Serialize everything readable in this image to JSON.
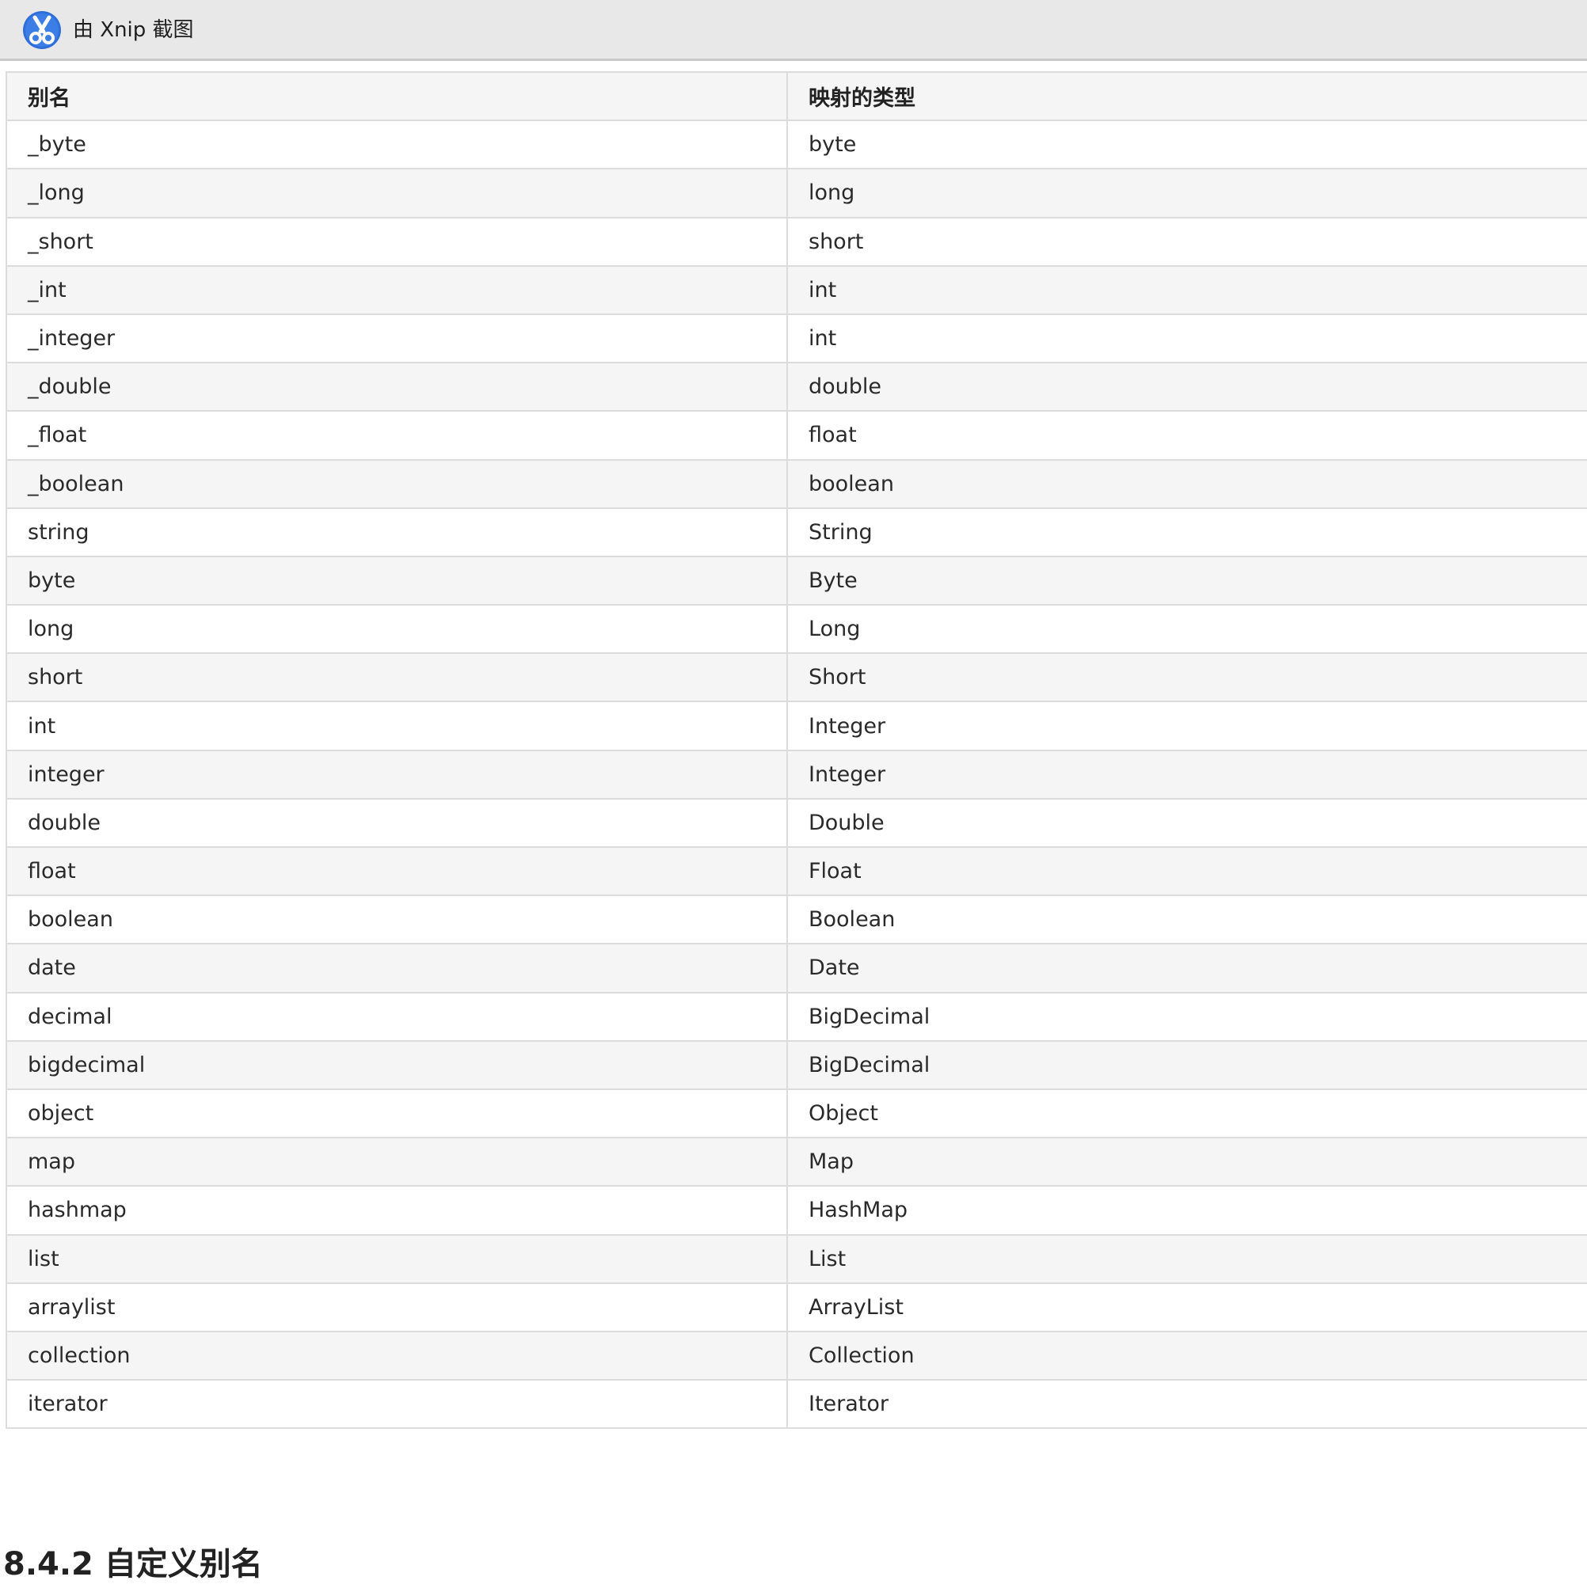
{
  "titlebar": {
    "label": "由 Xnip 截图",
    "icon": "scissors-icon",
    "icon_color": "#2f6fd9"
  },
  "table": {
    "headers": [
      "别名",
      "映射的类型"
    ],
    "rows": [
      [
        "_byte",
        "byte"
      ],
      [
        "_long",
        "long"
      ],
      [
        "_short",
        "short"
      ],
      [
        "_int",
        "int"
      ],
      [
        "_integer",
        "int"
      ],
      [
        "_double",
        "double"
      ],
      [
        "_float",
        "float"
      ],
      [
        "_boolean",
        "boolean"
      ],
      [
        "string",
        "String"
      ],
      [
        "byte",
        "Byte"
      ],
      [
        "long",
        "Long"
      ],
      [
        "short",
        "Short"
      ],
      [
        "int",
        "Integer"
      ],
      [
        "integer",
        "Integer"
      ],
      [
        "double",
        "Double"
      ],
      [
        "float",
        "Float"
      ],
      [
        "boolean",
        "Boolean"
      ],
      [
        "date",
        "Date"
      ],
      [
        "decimal",
        "BigDecimal"
      ],
      [
        "bigdecimal",
        "BigDecimal"
      ],
      [
        "object",
        "Object"
      ],
      [
        "map",
        "Map"
      ],
      [
        "hashmap",
        "HashMap"
      ],
      [
        "list",
        "List"
      ],
      [
        "arraylist",
        "ArrayList"
      ],
      [
        "collection",
        "Collection"
      ],
      [
        "iterator",
        "Iterator"
      ]
    ]
  },
  "section_heading": "8.4.2 自定义别名"
}
